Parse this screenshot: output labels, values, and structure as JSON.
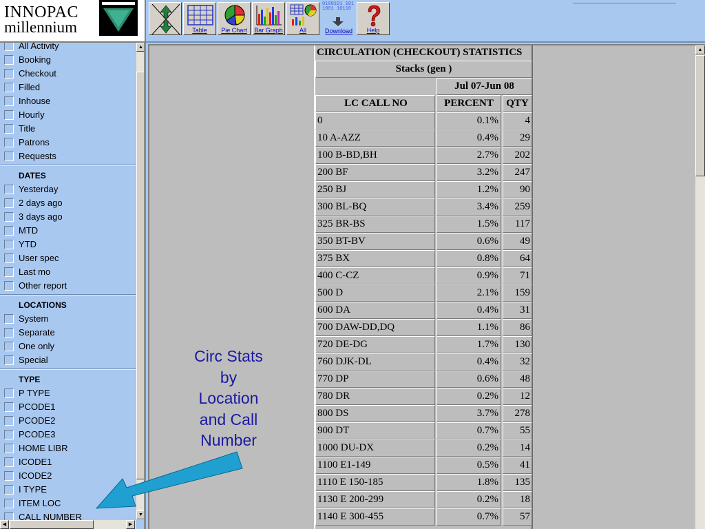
{
  "logo": {
    "line1": "INNOPAC",
    "line2": "millennium"
  },
  "toolbar": {
    "buttons": [
      {
        "label": ""
      },
      {
        "label": "Table"
      },
      {
        "label": "Pie Chart"
      },
      {
        "label": "Bar Graph"
      },
      {
        "label": "All"
      },
      {
        "label": "Download"
      },
      {
        "label": "Help"
      }
    ],
    "download_digits": "0100101 1011001 10110"
  },
  "sidebar": {
    "top_items": [
      "All Activity",
      "Booking",
      "Checkout",
      "Filled",
      "Inhouse",
      "Hourly",
      "Title",
      "Patrons",
      "Requests"
    ],
    "sections": [
      {
        "heading": "DATES",
        "items": [
          "Yesterday",
          "2 days ago",
          "3 days ago",
          "MTD",
          "YTD",
          "User spec",
          "Last mo",
          "Other report"
        ]
      },
      {
        "heading": "LOCATIONS",
        "items": [
          "System",
          "Separate",
          "One only",
          "Special"
        ]
      },
      {
        "heading": "TYPE",
        "items": [
          "P TYPE",
          "PCODE1",
          "PCODE2",
          "PCODE3",
          "HOME LIBR",
          "ICODE1",
          "ICODE2",
          "I TYPE",
          "ITEM LOC",
          "CALL NUMBER"
        ]
      }
    ]
  },
  "stats": {
    "title": "CIRCULATION (CHECKOUT) STATISTICS",
    "subtitle": "Stacks (gen )",
    "period": "Jul 07-Jun 08",
    "columns": {
      "name": "LC CALL NO",
      "percent": "PERCENT",
      "qty": "QTY"
    },
    "rows": [
      {
        "name": "0",
        "percent": "0.1%",
        "qty": "4"
      },
      {
        "name": "10 A-AZZ",
        "percent": "0.4%",
        "qty": "29"
      },
      {
        "name": "100 B-BD,BH",
        "percent": "2.7%",
        "qty": "202"
      },
      {
        "name": "200 BF",
        "percent": "3.2%",
        "qty": "247"
      },
      {
        "name": "250 BJ",
        "percent": "1.2%",
        "qty": "90"
      },
      {
        "name": "300 BL-BQ",
        "percent": "3.4%",
        "qty": "259"
      },
      {
        "name": "325 BR-BS",
        "percent": "1.5%",
        "qty": "117"
      },
      {
        "name": "350 BT-BV",
        "percent": "0.6%",
        "qty": "49"
      },
      {
        "name": "375 BX",
        "percent": "0.8%",
        "qty": "64"
      },
      {
        "name": "400 C-CZ",
        "percent": "0.9%",
        "qty": "71"
      },
      {
        "name": "500 D",
        "percent": "2.1%",
        "qty": "159"
      },
      {
        "name": "600 DA",
        "percent": "0.4%",
        "qty": "31"
      },
      {
        "name": "700 DAW-DD,DQ",
        "percent": "1.1%",
        "qty": "86"
      },
      {
        "name": "720 DE-DG",
        "percent": "1.7%",
        "qty": "130"
      },
      {
        "name": "760 DJK-DL",
        "percent": "0.4%",
        "qty": "32"
      },
      {
        "name": "770 DP",
        "percent": "0.6%",
        "qty": "48"
      },
      {
        "name": "780 DR",
        "percent": "0.2%",
        "qty": "12"
      },
      {
        "name": "800 DS",
        "percent": "3.7%",
        "qty": "278"
      },
      {
        "name": "900 DT",
        "percent": "0.7%",
        "qty": "55"
      },
      {
        "name": "1000 DU-DX",
        "percent": "0.2%",
        "qty": "14"
      },
      {
        "name": "1100 E1-149",
        "percent": "0.5%",
        "qty": "41"
      },
      {
        "name": "1110 E 150-185",
        "percent": "1.8%",
        "qty": "135"
      },
      {
        "name": "1130 E 200-299",
        "percent": "0.2%",
        "qty": "18"
      },
      {
        "name": "1140 E 300-455",
        "percent": "0.7%",
        "qty": "57"
      }
    ]
  },
  "annotation": {
    "lines": [
      "Circ Stats",
      "by",
      "Location",
      "and Call",
      "Number"
    ]
  },
  "colors": {
    "panel_bg": "#a9c8f0",
    "table_bg": "#bdbdbd",
    "annotation_text": "#1a1aa0",
    "arrow": "#1fa0d0"
  }
}
